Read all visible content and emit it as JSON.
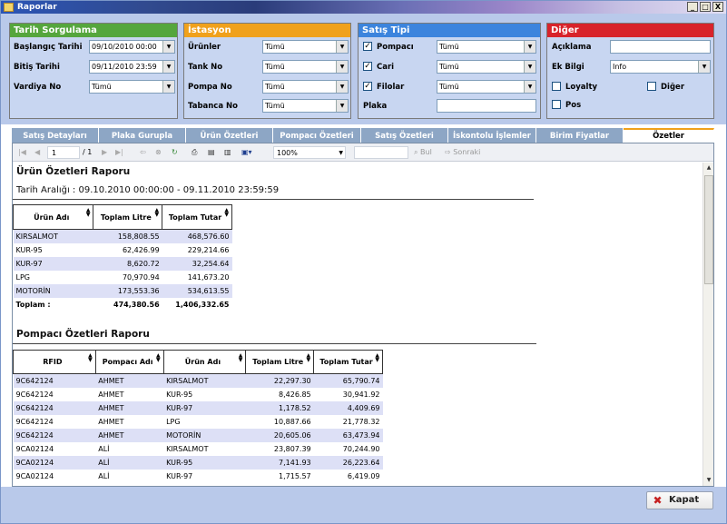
{
  "window": {
    "title": "Raporlar",
    "min": "_",
    "max": "□",
    "close": "X"
  },
  "panels": {
    "tarih": {
      "title": "Tarih Sorgulama",
      "baslangic_label": "Başlangıç Tarihi",
      "baslangic_value": "09/10/2010 00:00",
      "bitis_label": "Bitiş Tarihi",
      "bitis_value": "09/11/2010 23:59",
      "vardiya_label": "Vardiya No",
      "vardiya_value": "Tümü"
    },
    "istasyon": {
      "title": "İstasyon",
      "urunler_label": "Ürünler",
      "urunler_value": "Tümü",
      "tank_label": "Tank No",
      "tank_value": "Tümü",
      "pompa_label": "Pompa No",
      "pompa_value": "Tümü",
      "tabanca_label": "Tabanca No",
      "tabanca_value": "Tümü"
    },
    "satis": {
      "title": "Satış Tipi",
      "pompaci_label": "Pompacı",
      "pompaci_value": "Tümü",
      "cari_label": "Cari",
      "cari_value": "Tümü",
      "filolar_label": "Filolar",
      "filolar_value": "Tümü",
      "plaka_label": "Plaka",
      "plaka_value": ""
    },
    "diger": {
      "title": "Diğer",
      "aciklama_label": "Açıklama",
      "aciklama_value": "",
      "ekbilgi_label": "Ek Bilgi",
      "ekbilgi_value": "Info",
      "loyalty_label": "Loyalty",
      "diger_label": "Diğer",
      "pos_label": "Pos"
    }
  },
  "colors": {
    "tarih": "#55a63d",
    "istasyon": "#f0a11c",
    "satis": "#3c84dd",
    "diger": "#d8232a"
  },
  "tabs": [
    "Satış Detayları",
    "Plaka Gurupla",
    "Ürün Özetleri",
    "Pompacı Özetleri",
    "Satış Özetleri",
    "İskontolu İşlemler",
    "Birim Fiyatlar",
    "Özetler"
  ],
  "toolbar": {
    "page": "1",
    "of": "/ 1",
    "zoom": "100%",
    "find": "Bul",
    "next": "Sonraki"
  },
  "report1": {
    "title": "Ürün Özetleri Raporu",
    "range": "Tarih Aralığı : 09.10.2010 00:00:00 - 09.11.2010 23:59:59",
    "headers": [
      "Ürün Adı",
      "Toplam Litre",
      "Toplam Tutar"
    ],
    "rows": [
      [
        "KIRSALMOT",
        "158,808.55",
        "468,576.60"
      ],
      [
        "KUR-95",
        "62,426.99",
        "229,214.66"
      ],
      [
        "KUR-97",
        "8,620.72",
        "32,254.64"
      ],
      [
        "LPG",
        "70,970.94",
        "141,673.20"
      ],
      [
        "MOTORİN",
        "173,553.36",
        "534,613.55"
      ]
    ],
    "total": [
      "Toplam :",
      "474,380.56",
      "1,406,332.65"
    ]
  },
  "report2": {
    "title": "Pompacı Özetleri Raporu",
    "headers": [
      "RFID",
      "Pompacı Adı",
      "Ürün Adı",
      "Toplam Litre",
      "Toplam Tutar"
    ],
    "rows": [
      [
        "9C642124",
        "AHMET",
        "KIRSALMOT",
        "22,297.30",
        "65,790.74"
      ],
      [
        "9C642124",
        "AHMET",
        "KUR-95",
        "8,426.85",
        "30,941.92"
      ],
      [
        "9C642124",
        "AHMET",
        "KUR-97",
        "1,178.52",
        "4,409.69"
      ],
      [
        "9C642124",
        "AHMET",
        "LPG",
        "10,887.66",
        "21,778.32"
      ],
      [
        "9C642124",
        "AHMET",
        "MOTORİN",
        "20,605.06",
        "63,473.94"
      ],
      [
        "9CA02124",
        "ALİ",
        "KIRSALMOT",
        "23,807.39",
        "70,244.90"
      ],
      [
        "9CA02124",
        "ALİ",
        "KUR-95",
        "7,141.93",
        "26,223.64"
      ],
      [
        "9CA02124",
        "ALİ",
        "KUR-97",
        "1,715.57",
        "6,419.09"
      ]
    ]
  },
  "close_button": "Kapat"
}
